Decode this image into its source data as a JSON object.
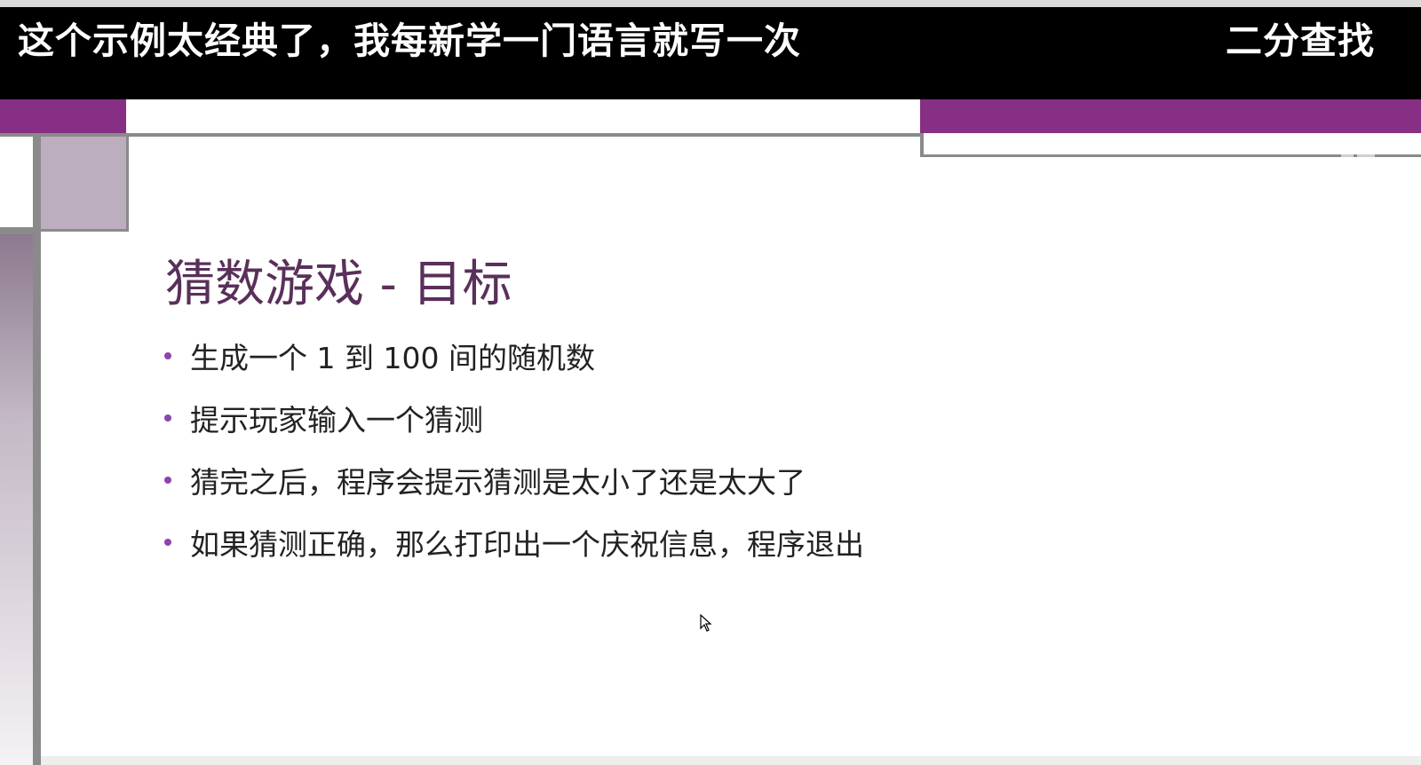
{
  "caption": {
    "left": "这个示例太经典了，我每新学一门语言就写一次",
    "right": "二分查找"
  },
  "watermark": "...",
  "slide": {
    "title": "猜数游戏 - 目标",
    "bullets": [
      "生成一个 1 到 100 间的随机数",
      "提示玩家输入一个猜测",
      "猜完之后，程序会提示猜测是太小了还是太大了",
      "如果猜测正确，那么打印出一个庆祝信息，程序退出"
    ]
  },
  "colors": {
    "accent_purple": "#862f84",
    "title_color": "#59305a",
    "bullet_color": "#8e44ad",
    "frame_gray": "#8a8a8a",
    "lilac": "#bcaebe"
  },
  "icons": {
    "cursor": "mouse-pointer-icon"
  }
}
